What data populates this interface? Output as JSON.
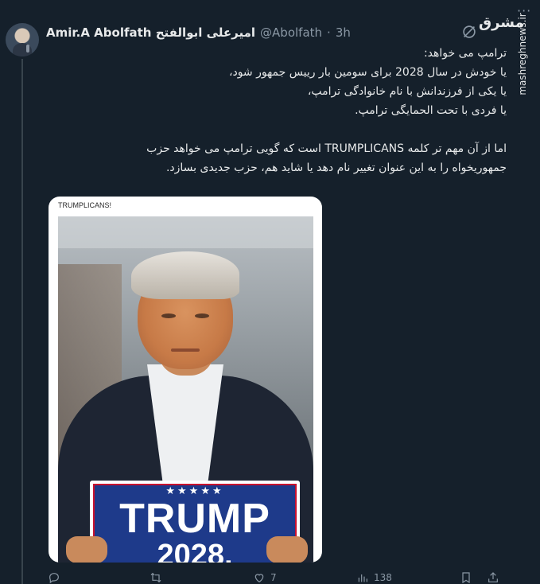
{
  "tweet": {
    "display_name": "Amir.A Abolfath امیرعلی ابوالفتح",
    "handle": "@Abolfath",
    "separator": "·",
    "time": "3h",
    "body": [
      "ترامپ می خواهد:",
      "یا خودش در سال 2028 برای سومین بار رییس جمهور شود،",
      "یا یکی از فرزندانش با نام خانوادگی ترامپ،",
      "یا فردی با تحت الحمایگی ترامپ.",
      "",
      "اما از آن مهم تر کلمه TRUMPLICANS است که گویی ترامپ می خواهد حزب",
      "جمهوریخواه را به این عنوان تغییر نام دهد یا شاید هم، حزب جدیدی بسازد."
    ],
    "media": {
      "caption": "TRUMPLICANS!",
      "sign_stars": "★★★★★",
      "sign_word": "TRUMP",
      "sign_year": "2028,"
    },
    "metrics": {
      "likes": "7",
      "views": "138"
    }
  },
  "watermark": {
    "logo": "مشرق",
    "site": "mashreghnews.ir"
  },
  "icons": {
    "more": "more-icon",
    "grok": "grok-icon",
    "reply": "reply-icon",
    "retweet": "retweet-icon",
    "like": "like-icon",
    "views": "views-icon",
    "bookmark": "bookmark-icon",
    "share": "share-icon"
  }
}
